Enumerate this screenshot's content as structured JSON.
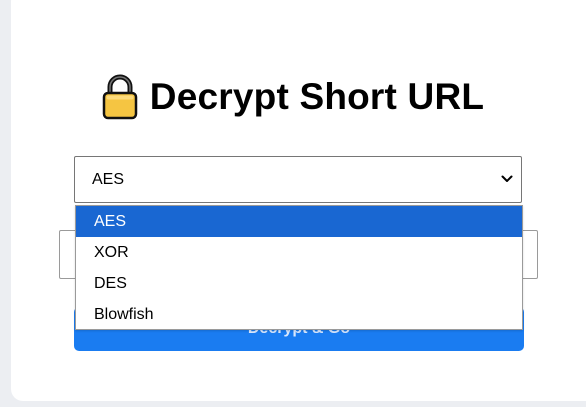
{
  "page": {
    "title": "Decrypt Short URL",
    "icon": "lock-icon"
  },
  "algorithm_select": {
    "selected_value": "AES",
    "options": [
      "AES",
      "XOR",
      "DES",
      "Blowfish"
    ],
    "highlighted_option": "AES"
  },
  "url_input": {
    "value": "",
    "placeholder": ""
  },
  "actions": {
    "decrypt_label": "Decrypt & Go"
  },
  "colors": {
    "accent": "#1a7cf1",
    "highlight": "#1967d2",
    "lock_body": "#f5c542",
    "lock_shackle": "#000000"
  }
}
